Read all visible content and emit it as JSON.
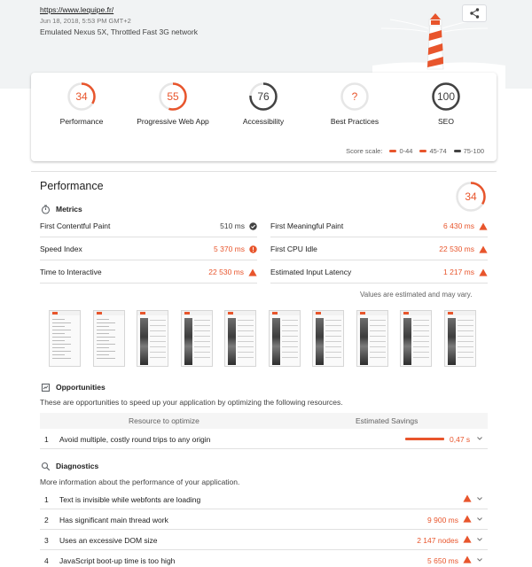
{
  "header": {
    "url": "https://www.lequipe.fr/",
    "date": "Jun 18, 2018, 5:53 PM GMT+2",
    "environment": "Emulated Nexus 5X, Throttled Fast 3G network",
    "share_icon": "share-icon"
  },
  "categories": [
    {
      "label": "Performance",
      "score": "34",
      "fraction": 0.34,
      "color": "#e8552c"
    },
    {
      "label": "Progressive Web App",
      "score": "55",
      "fraction": 0.55,
      "color": "#e8552c"
    },
    {
      "label": "Accessibility",
      "score": "76",
      "fraction": 0.76,
      "color": "#424242"
    },
    {
      "label": "Best Practices",
      "score": "?",
      "fraction": 0,
      "color": "#e8552c"
    },
    {
      "label": "SEO",
      "score": "100",
      "fraction": 1.0,
      "color": "#424242"
    }
  ],
  "score_scale": {
    "label": "Score scale:",
    "ranges": [
      {
        "label": "0-44",
        "color": "#e8552c"
      },
      {
        "label": "45-74",
        "color": "#e8552c"
      },
      {
        "label": "75-100",
        "color": "#424242"
      }
    ]
  },
  "performance": {
    "title": "Performance",
    "score": "34",
    "fraction": 0.34,
    "metrics_title": "Metrics",
    "metrics": [
      {
        "name": "First Contentful Paint",
        "value": "510 ms",
        "status": "pass"
      },
      {
        "name": "First Meaningful Paint",
        "value": "6 430 ms",
        "status": "fail"
      },
      {
        "name": "Speed Index",
        "value": "5 370 ms",
        "status": "average"
      },
      {
        "name": "First CPU Idle",
        "value": "22 530 ms",
        "status": "fail"
      },
      {
        "name": "Time to Interactive",
        "value": "22 530 ms",
        "status": "fail"
      },
      {
        "name": "Estimated Input Latency",
        "value": "1 217 ms",
        "status": "fail"
      }
    ],
    "estimated_note": "Values are estimated and may vary.",
    "filmstrip_count": 10
  },
  "opportunities": {
    "title": "Opportunities",
    "description": "These are opportunities to speed up your application by optimizing the following resources.",
    "col_resource": "Resource to optimize",
    "col_savings": "Estimated Savings",
    "items": [
      {
        "num": "1",
        "title": "Avoid multiple, costly round trips to any origin",
        "savings": "0,47 s"
      }
    ]
  },
  "diagnostics": {
    "title": "Diagnostics",
    "description": "More information about the performance of your application.",
    "items": [
      {
        "num": "1",
        "title": "Text is invisible while webfonts are loading",
        "value": ""
      },
      {
        "num": "2",
        "title": "Has significant main thread work",
        "value": "9 900 ms"
      },
      {
        "num": "3",
        "title": "Uses an excessive DOM size",
        "value": "2 147 nodes"
      },
      {
        "num": "4",
        "title": "JavaScript boot-up time is too high",
        "value": "5 650 ms"
      }
    ]
  },
  "colors": {
    "fail": "#e8552c",
    "neutral": "#424242",
    "pass": "#424242"
  }
}
